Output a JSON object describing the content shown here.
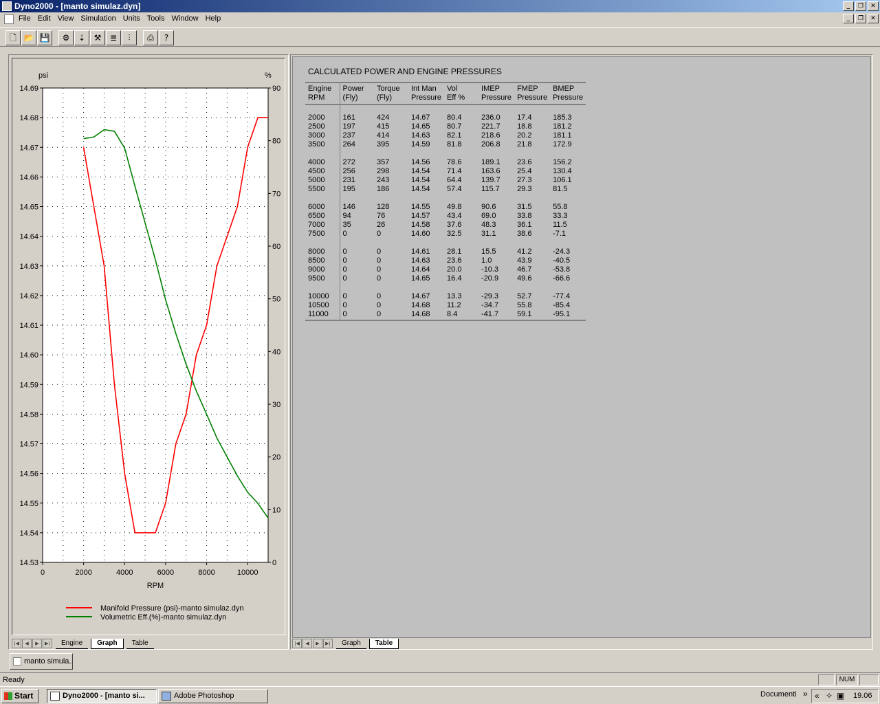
{
  "window": {
    "title": "Dyno2000 - [manto simulaz.dyn]"
  },
  "menu": [
    "File",
    "Edit",
    "View",
    "Simulation",
    "Units",
    "Tools",
    "Window",
    "Help"
  ],
  "graph": {
    "left_unit": "psi",
    "right_unit": "%",
    "xlabel": "RPM",
    "left_ticks": [
      "14.69",
      "14.68",
      "14.67",
      "14.66",
      "14.65",
      "14.64",
      "14.63",
      "14.62",
      "14.61",
      "14.60",
      "14.59",
      "14.58",
      "14.57",
      "14.56",
      "14.55",
      "14.54",
      "14.53"
    ],
    "right_ticks": [
      "90",
      "80",
      "70",
      "60",
      "50",
      "40",
      "30",
      "20",
      "10",
      "0"
    ],
    "x_ticks": [
      "0",
      "2000",
      "4000",
      "6000",
      "8000",
      "10000"
    ],
    "legend": [
      {
        "label": "Manifold Pressure (psi)-manto simulaz.dyn",
        "color": "#ff0000"
      },
      {
        "label": "Volumetric Eff.(%)-manto simulaz.dyn",
        "color": "#008000"
      }
    ]
  },
  "chart_data": {
    "type": "line",
    "xlabel": "RPM",
    "x": [
      2000,
      2500,
      3000,
      3500,
      4000,
      4500,
      5000,
      5500,
      6000,
      6500,
      7000,
      7500,
      8000,
      8500,
      9000,
      9500,
      10000,
      10500,
      11000
    ],
    "xlim": [
      0,
      11000
    ],
    "y_left": {
      "unit": "psi",
      "ylim": [
        14.53,
        14.69
      ]
    },
    "y_right": {
      "unit": "%",
      "ylim": [
        0,
        90
      ]
    },
    "series": [
      {
        "name": "Manifold Pressure (psi)-manto simulaz.dyn",
        "axis": "left",
        "color": "#ff0000",
        "values": [
          14.67,
          14.65,
          14.63,
          14.59,
          14.56,
          14.54,
          14.54,
          14.54,
          14.55,
          14.57,
          14.58,
          14.6,
          14.61,
          14.63,
          14.64,
          14.65,
          14.67,
          14.68,
          14.68
        ]
      },
      {
        "name": "Volumetric Eff.(%)-manto simulaz.dyn",
        "axis": "right",
        "color": "#008000",
        "values": [
          80.4,
          80.7,
          82.1,
          81.8,
          78.6,
          71.4,
          64.4,
          57.4,
          49.8,
          43.4,
          37.6,
          32.5,
          28.1,
          23.6,
          20.0,
          16.4,
          13.3,
          11.2,
          8.4
        ]
      }
    ],
    "grid": true
  },
  "left_tabs": [
    "Engine",
    "Graph",
    "Table"
  ],
  "right_tabs": [
    "Graph",
    "Table"
  ],
  "table": {
    "title": "CALCULATED POWER AND ENGINE PRESSURES",
    "headers": [
      [
        "Engine",
        "RPM"
      ],
      [
        "Power",
        "(Fly)"
      ],
      [
        "Torque",
        "(Fly)"
      ],
      [
        "Int Man",
        "Pressure"
      ],
      [
        "Vol",
        "Eff %"
      ],
      [
        "IMEP",
        "Pressure"
      ],
      [
        "FMEP",
        "Pressure"
      ],
      [
        "BMEP",
        "Pressure"
      ]
    ],
    "groups": [
      [
        [
          "2000",
          "161",
          "424",
          "14.67",
          "80.4",
          "236.0",
          "17.4",
          "185.3"
        ],
        [
          "2500",
          "197",
          "415",
          "14.65",
          "80.7",
          "221.7",
          "18.8",
          "181.2"
        ],
        [
          "3000",
          "237",
          "414",
          "14.63",
          "82.1",
          "218.6",
          "20.2",
          "181.1"
        ],
        [
          "3500",
          "264",
          "395",
          "14.59",
          "81.8",
          "206.8",
          "21.8",
          "172.9"
        ]
      ],
      [
        [
          "4000",
          "272",
          "357",
          "14.56",
          "78.6",
          "189.1",
          "23.6",
          "156.2"
        ],
        [
          "4500",
          "256",
          "298",
          "14.54",
          "71.4",
          "163.6",
          "25.4",
          "130.4"
        ],
        [
          "5000",
          "231",
          "243",
          "14.54",
          "64.4",
          "139.7",
          "27.3",
          "106.1"
        ],
        [
          "5500",
          "195",
          "186",
          "14.54",
          "57.4",
          "115.7",
          "29.3",
          "81.5"
        ]
      ],
      [
        [
          "6000",
          "146",
          "128",
          "14.55",
          "49.8",
          "90.6",
          "31.5",
          "55.8"
        ],
        [
          "6500",
          "94",
          "76",
          "14.57",
          "43.4",
          "69.0",
          "33.8",
          "33.3"
        ],
        [
          "7000",
          "35",
          "26",
          "14.58",
          "37.6",
          "48.3",
          "36.1",
          "11.5"
        ],
        [
          "7500",
          "0",
          "0",
          "14.60",
          "32.5",
          "31.1",
          "38.6",
          "-7.1"
        ]
      ],
      [
        [
          "8000",
          "0",
          "0",
          "14.61",
          "28.1",
          "15.5",
          "41.2",
          "-24.3"
        ],
        [
          "8500",
          "0",
          "0",
          "14.63",
          "23.6",
          "1.0",
          "43.9",
          "-40.5"
        ],
        [
          "9000",
          "0",
          "0",
          "14.64",
          "20.0",
          "-10.3",
          "46.7",
          "-53.8"
        ],
        [
          "9500",
          "0",
          "0",
          "14.65",
          "16.4",
          "-20.9",
          "49.6",
          "-66.6"
        ]
      ],
      [
        [
          "10000",
          "0",
          "0",
          "14.67",
          "13.3",
          "-29.3",
          "52.7",
          "-77.4"
        ],
        [
          "10500",
          "0",
          "0",
          "14.68",
          "11.2",
          "-34.7",
          "55.8",
          "-85.4"
        ],
        [
          "11000",
          "0",
          "0",
          "14.68",
          "8.4",
          "-41.7",
          "59.1",
          "-95.1"
        ]
      ]
    ]
  },
  "mdi_window": "manto simula...",
  "status": {
    "text": "Ready",
    "num": "NUM"
  },
  "taskbar": {
    "start": "Start",
    "tasks": [
      "Dyno2000 - [manto si...",
      "Adobe Photoshop"
    ],
    "documents": "Documenti",
    "clock": "19.06"
  }
}
